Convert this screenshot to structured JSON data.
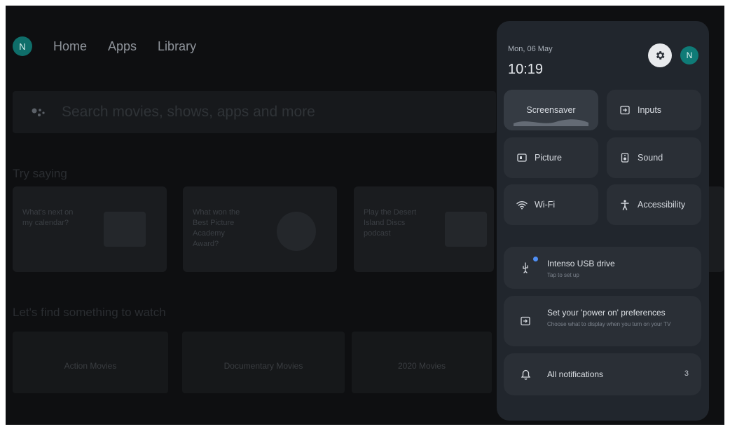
{
  "nav": {
    "avatar_letter": "N",
    "tabs": [
      "Home",
      "Apps",
      "Library"
    ]
  },
  "search": {
    "placeholder": "Search movies, shows, apps and more"
  },
  "sections": {
    "try_saying": "Try saying",
    "find": "Let's find something to watch"
  },
  "suggestions": [
    "What's next on my calendar?",
    "What won the Best Picture Academy Award?",
    "Play the Desert Island Discs podcast"
  ],
  "movies": [
    "Action Movies",
    "Documentary Movies",
    "2020 Movies"
  ],
  "panel": {
    "date": "Mon, 06 May",
    "time": "10:19",
    "avatar_letter": "N",
    "tiles": {
      "screensaver": "Screensaver",
      "inputs": "Inputs",
      "picture": "Picture",
      "sound": "Sound",
      "wifi": "Wi-Fi",
      "accessibility": "Accessibility"
    },
    "usb": {
      "title": "Intenso USB drive",
      "subtitle": "Tap to set up"
    },
    "power": {
      "title": "Set your 'power on' preferences",
      "subtitle": "Choose what to display when you turn on your TV"
    },
    "notifications": {
      "title": "All notifications",
      "count": "3"
    }
  },
  "colors": {
    "panel_bg": "#21262d",
    "tile_bg": "#2a2f36",
    "accent_dot": "#4f8ff5",
    "avatar": "#0f7b77"
  }
}
